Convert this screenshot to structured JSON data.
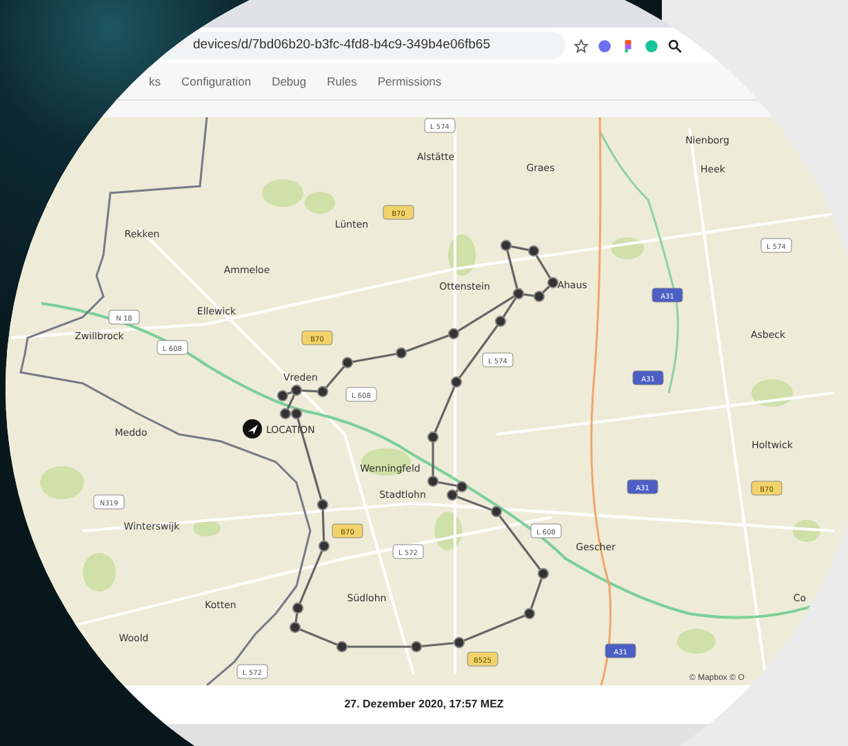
{
  "browser": {
    "url": "devices/d/7bd06b20-b3fc-4fd8-b4c9-349b4e06fb65"
  },
  "tabs": [
    {
      "label": "ks",
      "selected": false
    },
    {
      "label": "Configuration",
      "selected": false
    },
    {
      "label": "Debug",
      "selected": false
    },
    {
      "label": "Rules",
      "selected": false
    },
    {
      "label": "Permissions",
      "selected": false
    }
  ],
  "map": {
    "places": [
      {
        "name": "Alstätte"
      },
      {
        "name": "Graes"
      },
      {
        "name": "Nienborg"
      },
      {
        "name": "Heek"
      },
      {
        "name": "Rekken"
      },
      {
        "name": "Lünten"
      },
      {
        "name": "Ammeloe"
      },
      {
        "name": "Ottenstein"
      },
      {
        "name": "Ellewick"
      },
      {
        "name": "Zwillbrock"
      },
      {
        "name": "Asbeck"
      },
      {
        "name": "Vreden"
      },
      {
        "name": "Ahaus"
      },
      {
        "name": "Meddo"
      },
      {
        "name": "Wenningfeld"
      },
      {
        "name": "Stadtlohn"
      },
      {
        "name": "Holtwick"
      },
      {
        "name": "Winterswijk"
      },
      {
        "name": "Gescher"
      },
      {
        "name": "Kotten"
      },
      {
        "name": "Südlohn"
      },
      {
        "name": "Woold"
      },
      {
        "name": "Co"
      }
    ],
    "roads": [
      {
        "label": "L 574",
        "kind": "local"
      },
      {
        "label": "B70",
        "kind": "federal"
      },
      {
        "label": "N 18",
        "kind": "local"
      },
      {
        "label": "L 608",
        "kind": "local"
      },
      {
        "label": "B70",
        "kind": "federal"
      },
      {
        "label": "L 608",
        "kind": "local"
      },
      {
        "label": "L 574",
        "kind": "local"
      },
      {
        "label": "L 574",
        "kind": "local"
      },
      {
        "label": "A31",
        "kind": "motorway"
      },
      {
        "label": "A31",
        "kind": "motorway"
      },
      {
        "label": "N319",
        "kind": "local"
      },
      {
        "label": "B70",
        "kind": "federal"
      },
      {
        "label": "L 572",
        "kind": "local"
      },
      {
        "label": "L 608",
        "kind": "local"
      },
      {
        "label": "A31",
        "kind": "motorway"
      },
      {
        "label": "B70",
        "kind": "federal"
      },
      {
        "label": "B525",
        "kind": "federal"
      },
      {
        "label": "L 572",
        "kind": "local"
      },
      {
        "label": "A31",
        "kind": "motorway"
      }
    ],
    "marker_label": "LOCATION",
    "attribution": "© Mapbox © O"
  },
  "footer": {
    "timestamp": "27. Dezember 2020, 17:57 MEZ"
  }
}
